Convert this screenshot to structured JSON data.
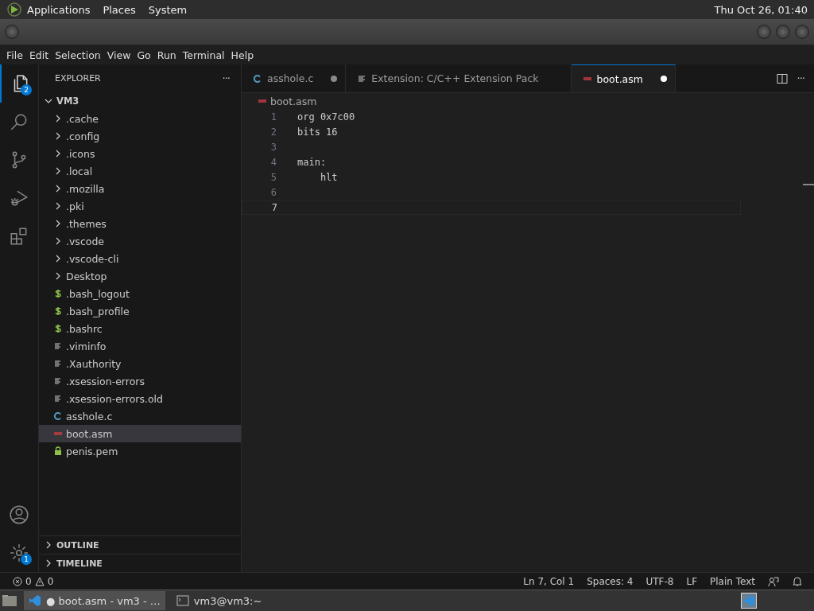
{
  "top_panel": {
    "menus": [
      "Applications",
      "Places",
      "System"
    ],
    "clock": "Thu Oct 26, 01:40"
  },
  "menu_bar": [
    "File",
    "Edit",
    "Selection",
    "View",
    "Go",
    "Run",
    "Terminal",
    "Help"
  ],
  "activity_bar": {
    "items": [
      {
        "kind": "explorer",
        "selected": true,
        "badge": "2"
      },
      {
        "kind": "search",
        "selected": false
      },
      {
        "kind": "source-control",
        "selected": false
      },
      {
        "kind": "run-debug",
        "selected": false
      },
      {
        "kind": "extensions",
        "selected": false
      }
    ],
    "bottom": [
      {
        "kind": "account"
      },
      {
        "kind": "settings",
        "badge": "1"
      }
    ]
  },
  "sidebar": {
    "title": "EXPLORER",
    "more": "···",
    "tree": [
      {
        "label": "VM3",
        "expanded": true,
        "children": [
          {
            "label": ".cache",
            "kind": "folder",
            "selected": false
          },
          {
            "label": ".config",
            "kind": "folder",
            "selected": false
          },
          {
            "label": ".icons",
            "kind": "folder",
            "selected": false
          },
          {
            "label": ".local",
            "kind": "folder",
            "selected": false
          },
          {
            "label": ".mozilla",
            "kind": "folder",
            "selected": false
          },
          {
            "label": ".pki",
            "kind": "folder",
            "selected": false
          },
          {
            "label": ".themes",
            "kind": "folder",
            "selected": false
          },
          {
            "label": ".vscode",
            "kind": "folder",
            "selected": false
          },
          {
            "label": ".vscode-cli",
            "kind": "folder",
            "selected": false
          },
          {
            "label": "Desktop",
            "kind": "folder",
            "selected": false
          },
          {
            "label": ".bash_logout",
            "kind": "shell",
            "selected": false
          },
          {
            "label": ".bash_profile",
            "kind": "shell",
            "selected": false
          },
          {
            "label": ".bashrc",
            "kind": "shell",
            "selected": false
          },
          {
            "label": ".viminfo",
            "kind": "text",
            "selected": false
          },
          {
            "label": ".Xauthority",
            "kind": "text",
            "selected": false
          },
          {
            "label": ".xsession-errors",
            "kind": "text",
            "selected": false
          },
          {
            "label": ".xsession-errors.old",
            "kind": "text",
            "selected": false
          },
          {
            "label": "asshole.c",
            "kind": "c",
            "selected": false
          },
          {
            "label": "boot.asm",
            "kind": "asm",
            "selected": true
          },
          {
            "label": "penis.pem",
            "kind": "lock",
            "selected": false
          }
        ]
      }
    ],
    "sections": [
      {
        "label": "OUTLINE",
        "expanded": false
      },
      {
        "label": "TIMELINE",
        "expanded": false
      }
    ]
  },
  "tabs": [
    {
      "label": "asshole.c",
      "kind": "c",
      "dirty": true,
      "selected": false
    },
    {
      "label": "Extension: C/C++ Extension Pack",
      "kind": "text",
      "dirty": false,
      "selected": false
    },
    {
      "label": "boot.asm",
      "kind": "asm",
      "dirty": true,
      "selected": true
    }
  ],
  "breadcrumb": "boot.asm",
  "code": [
    {
      "number": "1",
      "text": "org 0x7c00",
      "current": false
    },
    {
      "number": "2",
      "text": "bits 16",
      "current": false
    },
    {
      "number": "3",
      "current": false
    },
    {
      "number": "4",
      "text": "main:",
      "current": false
    },
    {
      "number": "5",
      "text": "    hlt",
      "current": false
    },
    {
      "number": "6",
      "current": false
    },
    {
      "number": "7",
      "current": true
    }
  ],
  "status_bar": {
    "errors": "0",
    "warnings": "0",
    "items": [
      "Ln 7, Col 1",
      "Spaces: 4",
      "UTF-8",
      "LF",
      "Plain Text"
    ]
  },
  "taskbar": [
    {
      "label": "● boot.asm - vm3 - …",
      "kind": "vscode",
      "selected": true
    },
    {
      "label": "vm3@vm3:~",
      "kind": "terminal",
      "selected": false
    }
  ]
}
